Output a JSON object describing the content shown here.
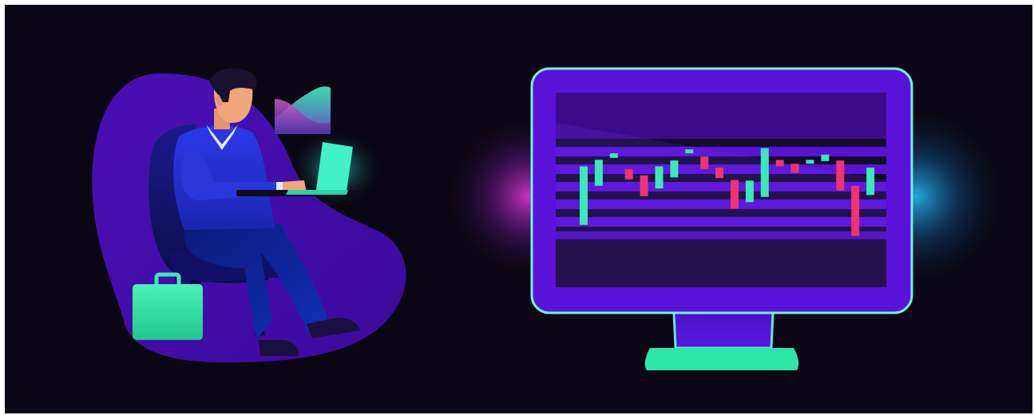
{
  "illustration": {
    "colors": {
      "background": "#0a0613",
      "purple": "#5a12d8",
      "deep_purple": "#3a0d86",
      "screen_dark": "#120b2a",
      "mint": "#2ee6a8",
      "cyan_glow": "#27c6ff",
      "magenta_glow": "#e83bd8",
      "up_candle": "#3be8b7",
      "down_candle": "#f0336f",
      "sweater_blue": "#1e2fd8",
      "skin": "#f1a57a",
      "hair": "#1a1030"
    },
    "icons": [
      "person-icon",
      "laptop-icon",
      "briefcase-icon",
      "chair-icon",
      "monitor-icon",
      "candlestick-chart-icon",
      "area-chart-icon"
    ]
  },
  "candles": [
    {
      "d": "up",
      "o": 2,
      "c": 11,
      "h": 11,
      "l": 2
    },
    {
      "d": "up",
      "o": 8,
      "c": 12,
      "h": 12,
      "l": 8
    },
    {
      "d": "up",
      "o": 12.3,
      "c": 13.0,
      "h": 13.0,
      "l": 12.3
    },
    {
      "d": "down",
      "o": 10.6,
      "c": 9.0,
      "h": 10.6,
      "l": 9.0
    },
    {
      "d": "down",
      "o": 9.6,
      "c": 6.4,
      "h": 9.6,
      "l": 6.4
    },
    {
      "d": "up",
      "o": 7.6,
      "c": 11.0,
      "h": 11.0,
      "l": 7.6
    },
    {
      "d": "up",
      "o": 9.3,
      "c": 11.9,
      "h": 11.9,
      "l": 9.3
    },
    {
      "d": "up",
      "o": 13.0,
      "c": 13.6,
      "h": 13.6,
      "l": 13.0
    },
    {
      "d": "down",
      "o": 12.5,
      "c": 10.6,
      "h": 12.5,
      "l": 10.6
    },
    {
      "d": "down",
      "o": 10.8,
      "c": 9.2,
      "h": 10.8,
      "l": 9.2
    },
    {
      "d": "down",
      "o": 8.9,
      "c": 4.5,
      "h": 8.9,
      "l": 4.5
    },
    {
      "d": "up",
      "o": 5.5,
      "c": 8.8,
      "h": 8.8,
      "l": 5.5
    },
    {
      "d": "up",
      "o": 6.3,
      "c": 13.8,
      "h": 13.8,
      "l": 6.3
    },
    {
      "d": "down",
      "o": 12.0,
      "c": 11.0,
      "h": 12.0,
      "l": 11.0
    },
    {
      "d": "down",
      "o": 11.4,
      "c": 10.0,
      "h": 11.4,
      "l": 10.0
    },
    {
      "d": "up",
      "o": 11.4,
      "c": 12.0,
      "h": 12.0,
      "l": 11.4
    },
    {
      "d": "up",
      "o": 11.8,
      "c": 12.8,
      "h": 12.8,
      "l": 11.8
    },
    {
      "d": "down",
      "o": 11.9,
      "c": 7.3,
      "h": 11.9,
      "l": 7.3
    },
    {
      "d": "down",
      "o": 8.0,
      "c": 0.3,
      "h": 8.0,
      "l": 0.3
    },
    {
      "d": "up",
      "o": 6.6,
      "c": 10.8,
      "h": 10.8,
      "l": 6.6
    }
  ]
}
